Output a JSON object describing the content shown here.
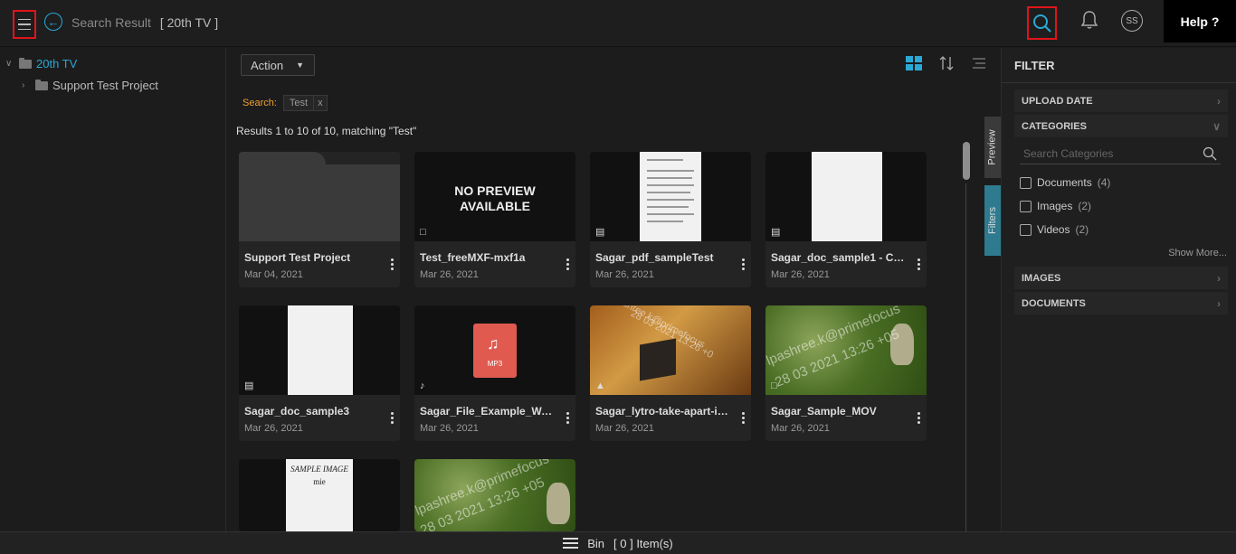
{
  "header": {
    "crumb_title": "Search Result",
    "crumb_context": "[ 20th TV ]",
    "avatar_initials": "SS",
    "help_label": "Help ?"
  },
  "tree": {
    "root": "20th TV",
    "child": "Support Test Project"
  },
  "toolbar": {
    "action_label": "Action"
  },
  "search": {
    "label": "Search:",
    "chip": "Test",
    "chip_remove": "x"
  },
  "results_text": "Results 1 to 10 of 10, matching \"Test\"",
  "cards": [
    {
      "title": "Support Test Project",
      "date": "Mar 04, 2021",
      "kind": "folder"
    },
    {
      "title": "Test_freeMXF-mxf1a",
      "date": "Mar 26, 2021",
      "kind": "video"
    },
    {
      "title": "Sagar_pdf_sampleTest",
      "date": "Mar 26, 2021",
      "kind": "document"
    },
    {
      "title": "Sagar_doc_sample1 - Co...",
      "date": "Mar 26, 2021",
      "kind": "document"
    },
    {
      "title": "Sagar_doc_sample3",
      "date": "Mar 26, 2021",
      "kind": "document"
    },
    {
      "title": "Sagar_File_Example_WA...",
      "date": "Mar 26, 2021",
      "kind": "audio"
    },
    {
      "title": "Sagar_lytro-take-apart-i2...",
      "date": "Mar 26, 2021",
      "kind": "image"
    },
    {
      "title": "Sagar_Sample_MOV",
      "date": "Mar 26, 2021",
      "kind": "video"
    },
    {
      "title": "",
      "date": "",
      "kind": "document"
    },
    {
      "title": "",
      "date": "",
      "kind": "image"
    }
  ],
  "thumbs": {
    "no_preview_line1": "NO PREVIEW",
    "no_preview_line2": "AVAILABLE",
    "mp3_label": "MP3",
    "photo_watermark_1": "shilpashree.k@primefocus",
    "photo_watermark_2": "28 03 2021 13:26 +0",
    "photo_watermark_3": "lpashree.k@primefocus",
    "photo_watermark_4": "28 03 2021 13:26 +05",
    "sample_image_t1": "SAMPLE IMAGE",
    "sample_image_t2": "mie"
  },
  "side_tabs": {
    "preview": "Preview",
    "filters": "Filters"
  },
  "filter": {
    "title": "FILTER",
    "upload_date": "UPLOAD DATE",
    "categories": "CATEGORIES",
    "search_placeholder": "Search Categories",
    "options": [
      {
        "label": "Documents",
        "count": "(4)"
      },
      {
        "label": "Images",
        "count": "(2)"
      },
      {
        "label": "Videos",
        "count": "(2)"
      }
    ],
    "show_more": "Show More...",
    "images": "IMAGES",
    "documents": "DOCUMENTS"
  },
  "bottom": {
    "bin_label": "Bin",
    "bin_count": "[ 0 ] Item(s)"
  },
  "colors": {
    "accent": "#2aa8d6",
    "highlight_red": "#e0141a",
    "search_label": "#f0a030",
    "filters_tab": "#2e7b8f"
  }
}
